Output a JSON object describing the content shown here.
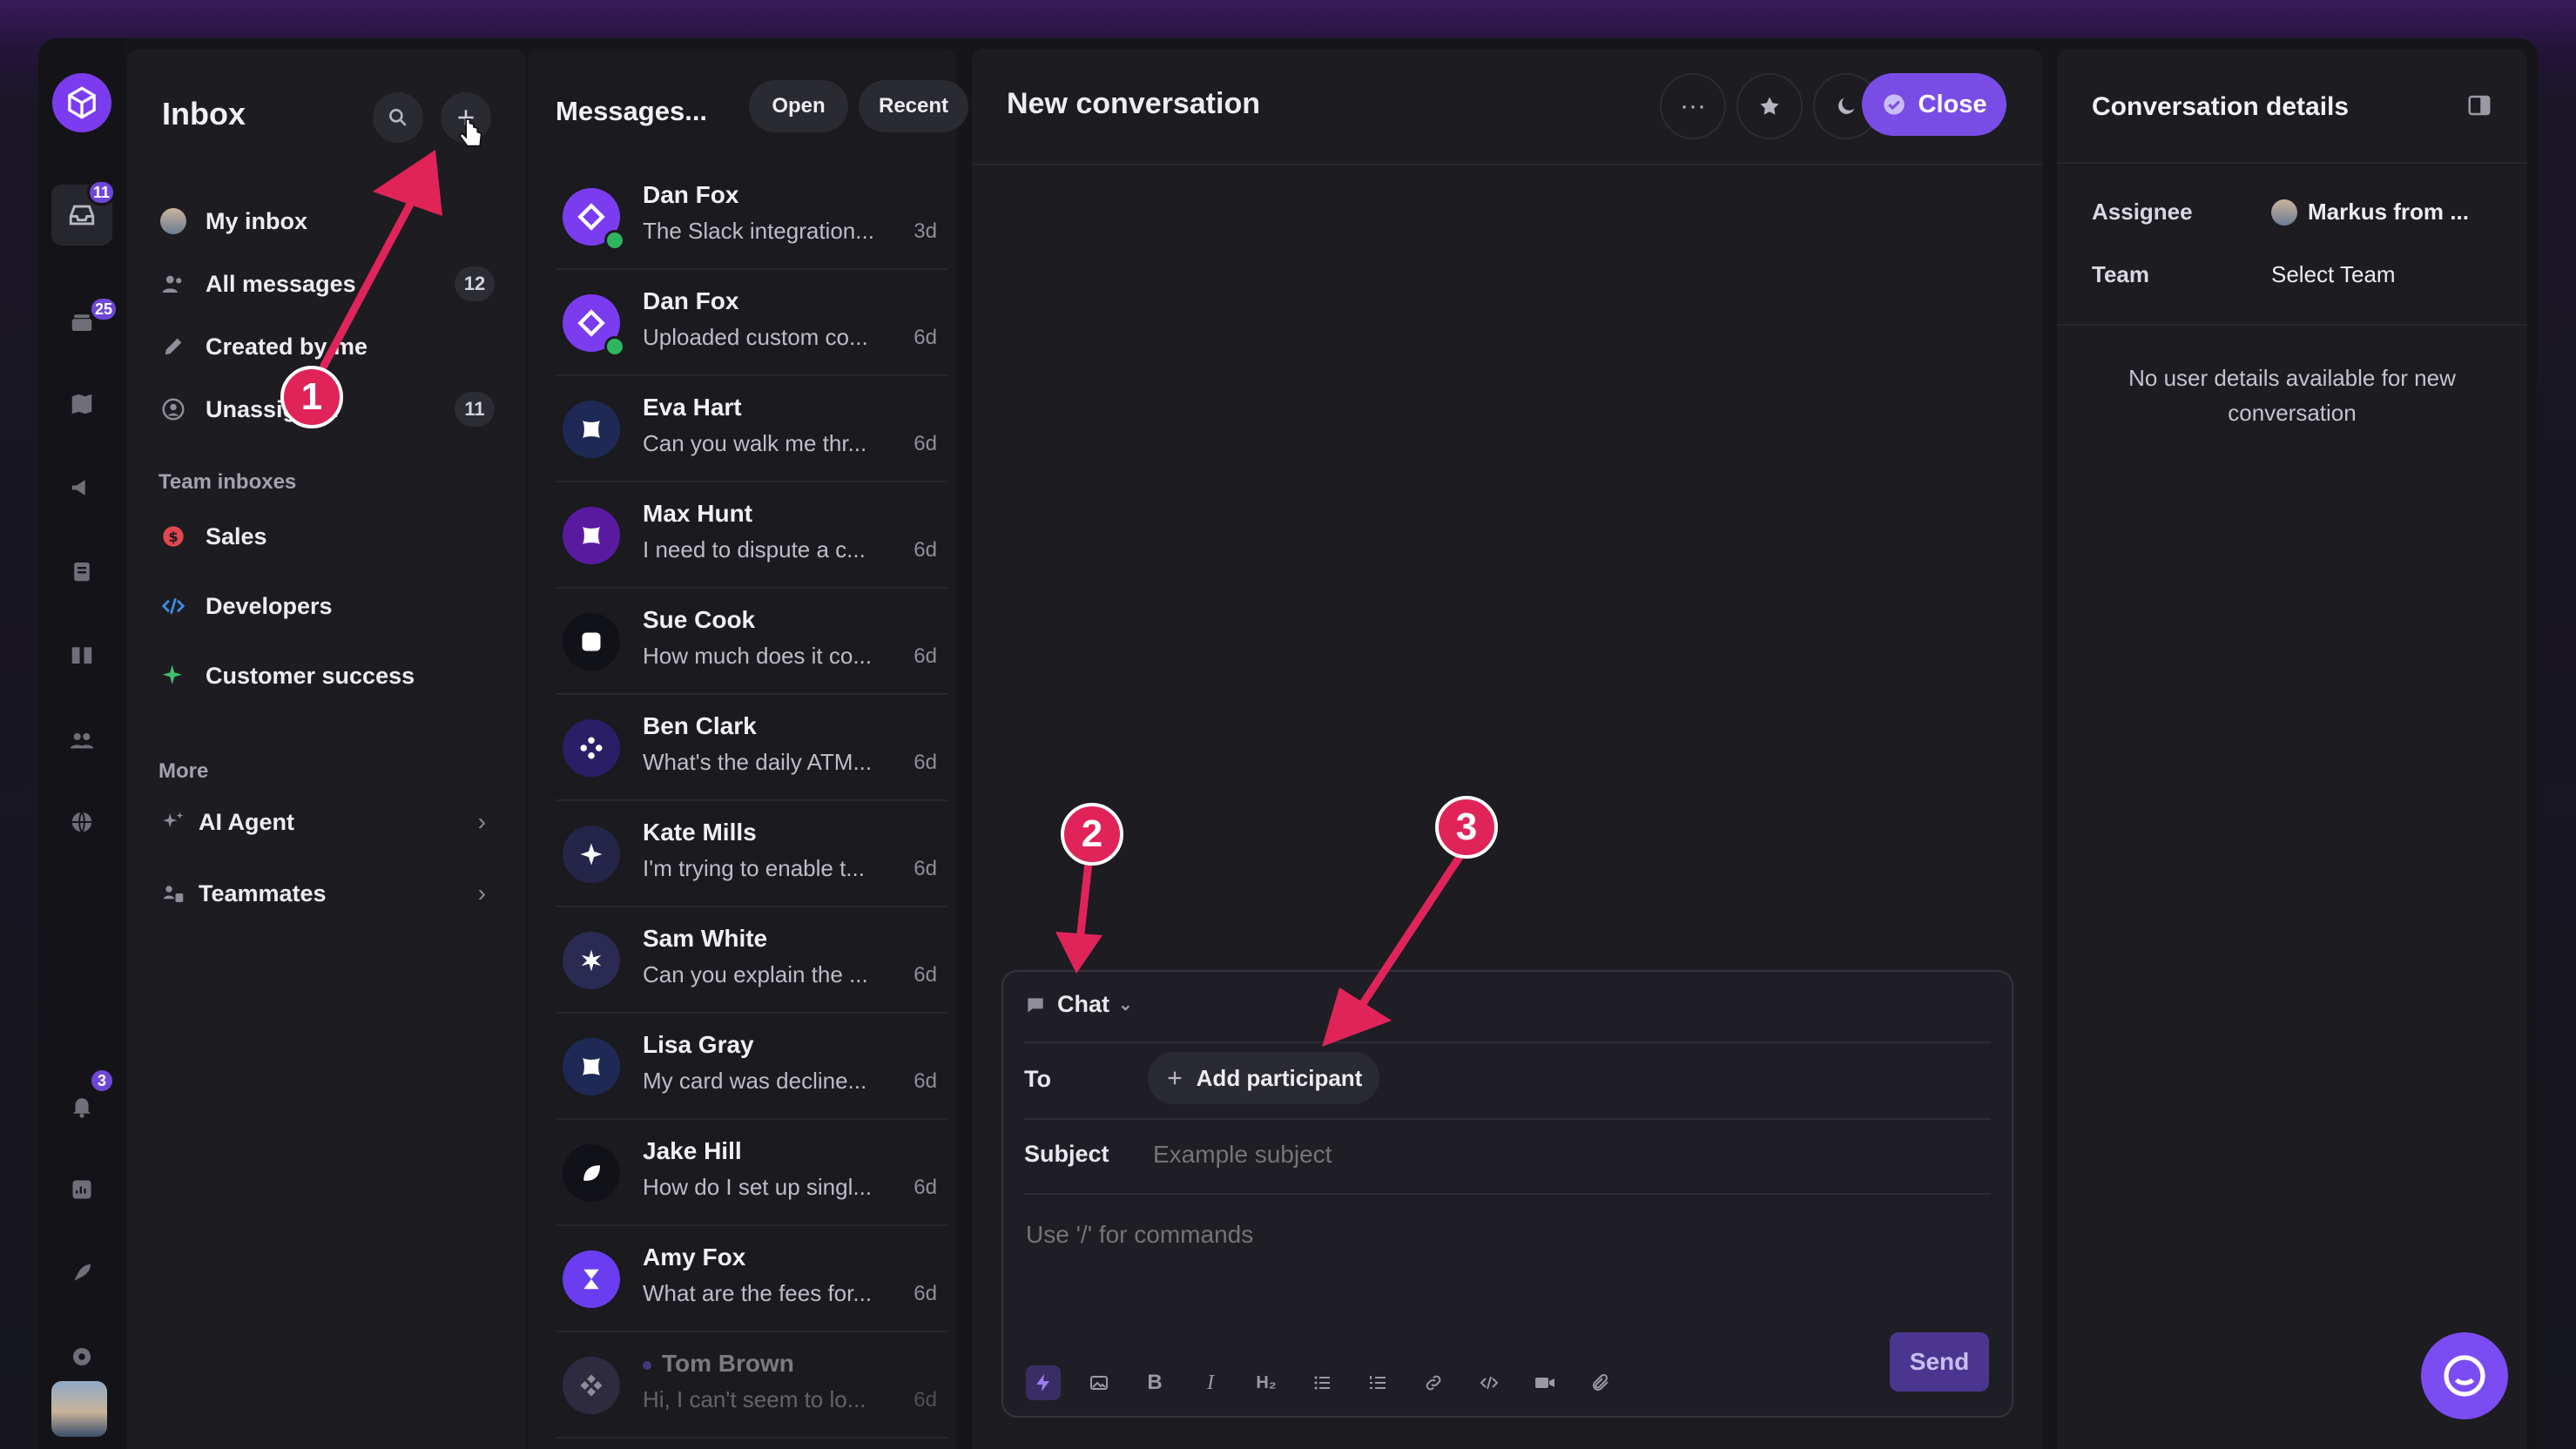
{
  "rail": {
    "badges": {
      "inbox": "11",
      "stack": "25",
      "bell": "3"
    }
  },
  "sidebar": {
    "title": "Inbox",
    "items": [
      {
        "label": "My inbox",
        "count": ""
      },
      {
        "label": "All messages",
        "count": "12"
      },
      {
        "label": "Created by me",
        "count": ""
      },
      {
        "label": "Unassigned",
        "count": "11"
      }
    ],
    "team_label": "Team inboxes",
    "teams": [
      {
        "label": "Sales",
        "icon": "dollar-icon"
      },
      {
        "label": "Developers",
        "icon": "code-icon"
      },
      {
        "label": "Customer success",
        "icon": "sparkle-icon"
      }
    ],
    "more_label": "More",
    "more": [
      {
        "label": "AI Agent",
        "icon": "sparkles-icon"
      },
      {
        "label": "Teammates",
        "icon": "teammates-icon"
      }
    ]
  },
  "messages": {
    "title": "Messages...",
    "filter_open": "Open",
    "filter_recent": "Recent",
    "items": [
      {
        "name": "Dan Fox",
        "preview": "The Slack integration...",
        "time": "3d",
        "color": "#7b3cf0"
      },
      {
        "name": "Dan Fox",
        "preview": "Uploaded custom co...",
        "time": "6d",
        "color": "#7b3cf0"
      },
      {
        "name": "Eva Hart",
        "preview": "Can you walk me thr...",
        "time": "6d",
        "color": "#1e2a55"
      },
      {
        "name": "Max Hunt",
        "preview": "I need to dispute a c...",
        "time": "6d",
        "color": "#5a1aa0"
      },
      {
        "name": "Sue Cook",
        "preview": "How much does it co...",
        "time": "6d",
        "color": "#111118"
      },
      {
        "name": "Ben Clark",
        "preview": "What's the daily ATM...",
        "time": "6d",
        "color": "#2a1e66"
      },
      {
        "name": "Kate Mills",
        "preview": "I'm trying to enable t...",
        "time": "6d",
        "color": "#25254a"
      },
      {
        "name": "Sam White",
        "preview": "Can you explain the ...",
        "time": "6d",
        "color": "#2a2a52"
      },
      {
        "name": "Lisa Gray",
        "preview": "My card was decline...",
        "time": "6d",
        "color": "#1e2a55"
      },
      {
        "name": "Jake Hill",
        "preview": "How do I set up singl...",
        "time": "6d",
        "color": "#111118"
      },
      {
        "name": "Amy Fox",
        "preview": "What are the fees for...",
        "time": "6d",
        "color": "#6a3ef0"
      },
      {
        "name": "Tom Brown",
        "preview": "Hi, I can't seem to lo...",
        "time": "6d",
        "color": "#2e2a40"
      }
    ]
  },
  "conversation": {
    "title": "New conversation",
    "close_label": "Close",
    "channel": "Chat",
    "to_label": "To",
    "add_participant": "Add participant",
    "subject_label": "Subject",
    "subject_placeholder": "Example subject",
    "body_placeholder": "Use '/' for commands",
    "send_label": "Send"
  },
  "details": {
    "title": "Conversation details",
    "assignee_label": "Assignee",
    "assignee_value": "Markus from ...",
    "team_label": "Team",
    "team_value": "Select Team",
    "empty_text": "No user details available for new conversation"
  },
  "annotations": {
    "one": "1",
    "two": "2",
    "three": "3",
    "color": "#e0245a"
  }
}
